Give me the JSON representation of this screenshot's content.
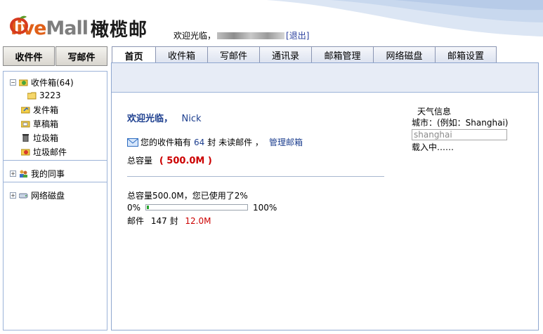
{
  "logo": {
    "prefix": "O",
    "word_colored": "live",
    "word_gray": "Mall",
    "cn": "橄榄邮"
  },
  "header": {
    "welcome": "欢迎光临，",
    "logout": "[退出]"
  },
  "left_buttons": {
    "receive": "收件件",
    "compose": "写邮件"
  },
  "sidebar": {
    "inbox": "收件箱(64)",
    "inbox_sub": "3223",
    "sent": "发件箱",
    "drafts": "草稿箱",
    "trash": "垃圾箱",
    "spam": "垃圾邮件",
    "colleagues": "我的同事",
    "netdisk": "网络磁盘"
  },
  "tabs": [
    {
      "label": "首页"
    },
    {
      "label": "收件箱"
    },
    {
      "label": "写邮件"
    },
    {
      "label": "通讯录"
    },
    {
      "label": "邮箱管理"
    },
    {
      "label": "网络磁盘"
    },
    {
      "label": "邮箱设置"
    }
  ],
  "main": {
    "greeting": "欢迎光临，",
    "user": "Nick",
    "inbox_prefix": "您的收件箱有",
    "unread_count": "64",
    "inbox_suffix": "封  未读邮件  ，",
    "manage_link": "管理邮箱",
    "capacity_label": "总容量",
    "capacity_value": "( 500.0M )",
    "usage_text": "总容量500.0M，您已使用了2%",
    "bar_min": "0%",
    "bar_max": "100%",
    "usage_fraction": 0.02,
    "mail_label": "邮件",
    "mail_count": "147 封",
    "mail_size": "12.0M"
  },
  "weather": {
    "title": "天气信息",
    "city_hint": "城市：(例如：Shanghai)",
    "input_value": "shanghai",
    "loading": "载入中……"
  },
  "colors": {
    "accent_red": "#cc0000",
    "link_blue": "#1d3f8f",
    "logo_orange": "#e06019",
    "progress_green": "#26a52b"
  }
}
